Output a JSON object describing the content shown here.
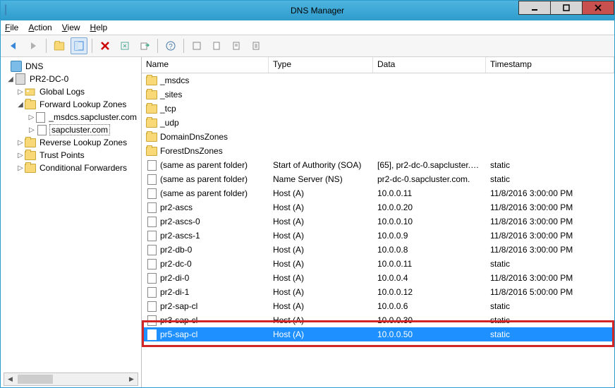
{
  "window": {
    "title": "DNS Manager"
  },
  "menu": {
    "file": "File",
    "action": "Action",
    "view": "View",
    "help": "Help"
  },
  "tree": {
    "root": "DNS",
    "server": "PR2-DC-0",
    "nodes": {
      "global_logs": "Global Logs",
      "fwd": "Forward Lookup Zones",
      "msdcs": "_msdcs.sapcluster.com",
      "zone": "sapcluster.com",
      "rev": "Reverse Lookup Zones",
      "trust": "Trust Points",
      "cond": "Conditional Forwarders"
    }
  },
  "columns": {
    "name": "Name",
    "type": "Type",
    "data": "Data",
    "ts": "Timestamp"
  },
  "folders": [
    {
      "name": "_msdcs"
    },
    {
      "name": "_sites"
    },
    {
      "name": "_tcp"
    },
    {
      "name": "_udp"
    },
    {
      "name": "DomainDnsZones"
    },
    {
      "name": "ForestDnsZones"
    }
  ],
  "records": [
    {
      "name": "(same as parent folder)",
      "type": "Start of Authority (SOA)",
      "data": "[65], pr2-dc-0.sapcluster.c...",
      "ts": "static"
    },
    {
      "name": "(same as parent folder)",
      "type": "Name Server (NS)",
      "data": "pr2-dc-0.sapcluster.com.",
      "ts": "static"
    },
    {
      "name": "(same as parent folder)",
      "type": "Host (A)",
      "data": "10.0.0.11",
      "ts": "11/8/2016 3:00:00 PM"
    },
    {
      "name": "pr2-ascs",
      "type": "Host (A)",
      "data": "10.0.0.20",
      "ts": "11/8/2016 3:00:00 PM"
    },
    {
      "name": "pr2-ascs-0",
      "type": "Host (A)",
      "data": "10.0.0.10",
      "ts": "11/8/2016 3:00:00 PM"
    },
    {
      "name": "pr2-ascs-1",
      "type": "Host (A)",
      "data": "10.0.0.9",
      "ts": "11/8/2016 3:00:00 PM"
    },
    {
      "name": "pr2-db-0",
      "type": "Host (A)",
      "data": "10.0.0.8",
      "ts": "11/8/2016 3:00:00 PM"
    },
    {
      "name": "pr2-dc-0",
      "type": "Host (A)",
      "data": "10.0.0.11",
      "ts": "static"
    },
    {
      "name": "pr2-di-0",
      "type": "Host (A)",
      "data": "10.0.0.4",
      "ts": "11/8/2016 3:00:00 PM"
    },
    {
      "name": "pr2-di-1",
      "type": "Host (A)",
      "data": "10.0.0.12",
      "ts": "11/8/2016 5:00:00 PM"
    },
    {
      "name": "pr2-sap-cl",
      "type": "Host (A)",
      "data": "10.0.0.6",
      "ts": "static"
    },
    {
      "name": "pr3-sap-cl",
      "type": "Host (A)",
      "data": "10.0.0.30",
      "ts": "static"
    },
    {
      "name": "pr5-sap-cl",
      "type": "Host (A)",
      "data": "10.0.0.50",
      "ts": "static",
      "selected": true
    }
  ],
  "highlight_row_index": 12
}
